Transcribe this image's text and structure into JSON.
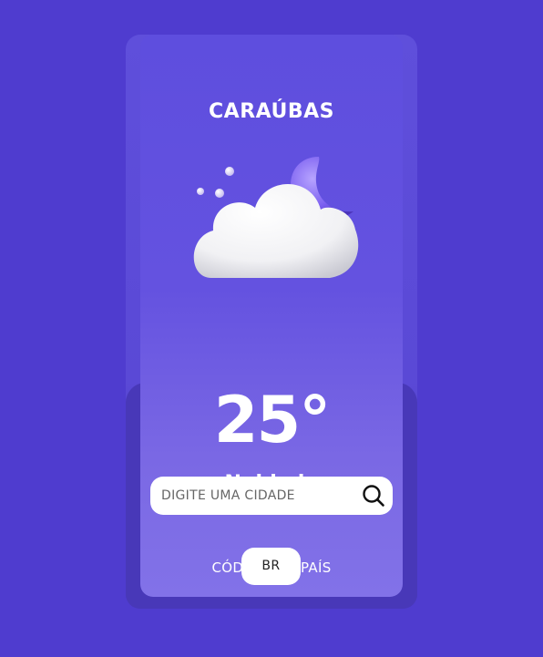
{
  "weather": {
    "city": "CARAÚBAS",
    "temperature": "25°",
    "description": "Nublado",
    "icon": "cloud-moon-icon"
  },
  "search": {
    "placeholder": "DIGITE UMA CIDADE",
    "value": "",
    "icon": "search-icon"
  },
  "country": {
    "label": "CÓDIGO DO PAÍS",
    "code": "BR"
  },
  "colors": {
    "background": "#4f3ccf",
    "card_top": "#5e4ede",
    "card_bottom": "#8272e8",
    "moon": "#7a5ef0",
    "text": "#ffffff"
  }
}
